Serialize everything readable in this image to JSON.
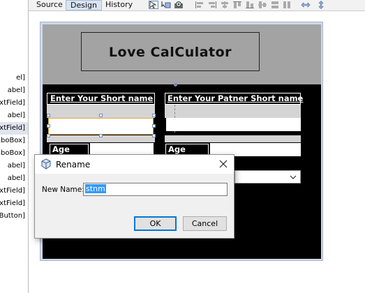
{
  "toolbar": {
    "tabs": [
      {
        "label": "Source",
        "active": false
      },
      {
        "label": "Design",
        "active": true
      },
      {
        "label": "History",
        "active": false
      }
    ]
  },
  "inspector": {
    "items": [
      {
        "label": "el]",
        "selected": false
      },
      {
        "label": "abel]",
        "selected": false
      },
      {
        "label": "xtField]",
        "selected": false
      },
      {
        "label": "abel]",
        "selected": false
      },
      {
        "label": "xtField]",
        "selected": true
      },
      {
        "label": "mboBox]",
        "selected": false
      },
      {
        "label": "mboBox]",
        "selected": false
      },
      {
        "label": "abel]",
        "selected": false
      },
      {
        "label": "abel]",
        "selected": false
      },
      {
        "label": "xtField]",
        "selected": false
      },
      {
        "label": "xtField]",
        "selected": false
      },
      {
        "label": "Button]",
        "selected": false
      }
    ]
  },
  "form": {
    "title": "Love CalCulator",
    "label_short_name": "Enter Your Short name",
    "label_partner_short_name": "Enter Your Patner Short name",
    "label_age_1": "Age",
    "label_age_2": "Age"
  },
  "dialog": {
    "title": "Rename",
    "field_label": "New Name:",
    "field_value": "stnm",
    "ok_label": "OK",
    "cancel_label": "Cancel"
  },
  "colors": {
    "form_background": "#000000",
    "header_background": "#a3a3a3",
    "selection": "#3399ff",
    "active_tab": "#d9e4f3"
  }
}
